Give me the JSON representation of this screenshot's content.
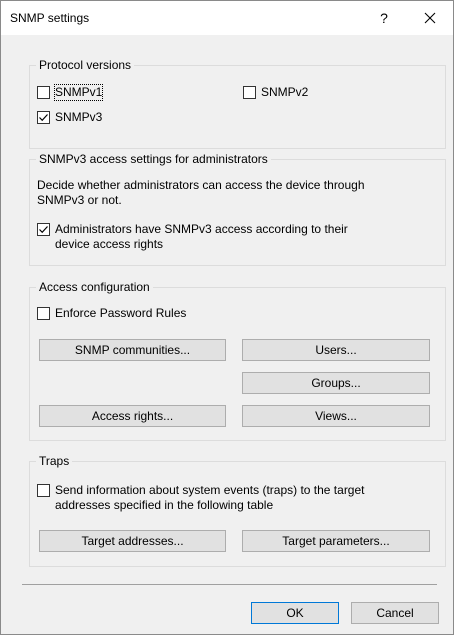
{
  "dialog": {
    "title": "SNMP settings",
    "help_label": "?",
    "close_icon": "close-icon"
  },
  "protocol_versions": {
    "legend": "Protocol versions",
    "snmpv1": {
      "label": "SNMPv1",
      "checked": false
    },
    "snmpv2": {
      "label": "SNMPv2",
      "checked": false
    },
    "snmpv3": {
      "label": "SNMPv3",
      "checked": true
    }
  },
  "snmpv3_access": {
    "legend": "SNMPv3 access settings for administrators",
    "description_line1": "Decide whether administrators can access the device through",
    "description_line2": "SNMPv3 or not.",
    "admin_access": {
      "label_line1": "Administrators have SNMPv3 access according to their",
      "label_line2": "device access rights",
      "checked": true
    }
  },
  "access_configuration": {
    "legend": "Access configuration",
    "enforce_password_rules": {
      "label": "Enforce Password Rules",
      "checked": false
    },
    "snmp_communities_label": "SNMP communities...",
    "users_label": "Users...",
    "groups_label": "Groups...",
    "access_rights_label": "Access rights...",
    "views_label": "Views..."
  },
  "traps": {
    "legend": "Traps",
    "send_traps": {
      "label_line1": "Send information about system events (traps) to the target",
      "label_line2": "addresses specified in the following table",
      "checked": false
    },
    "target_addresses_label": "Target addresses...",
    "target_parameters_label": "Target parameters..."
  },
  "footer": {
    "ok_label": "OK",
    "cancel_label": "Cancel"
  },
  "colors": {
    "dialog_background": "#f0f0f0",
    "titlebar_background": "#ffffff",
    "button_face": "#e1e1e1",
    "default_button_border": "#0078d7",
    "group_border": "#dcdcdc"
  }
}
